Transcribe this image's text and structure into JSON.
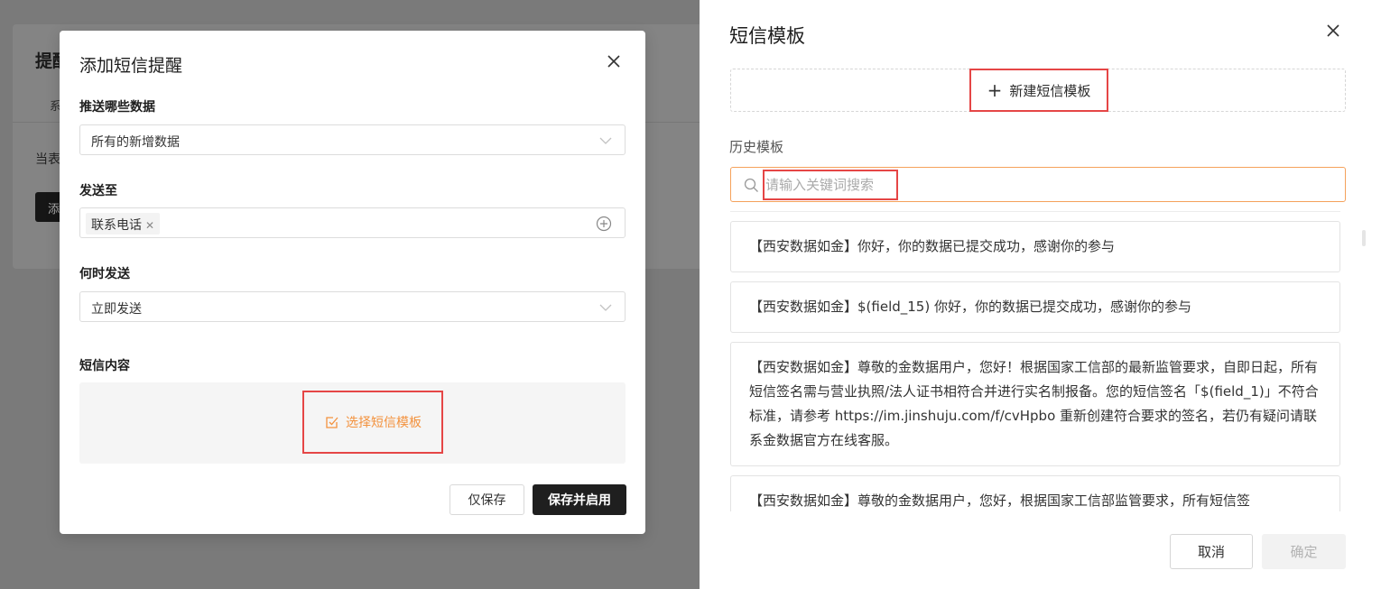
{
  "background_page": {
    "title": "提醒",
    "tab": "系",
    "text": "当表",
    "button": "添"
  },
  "modal": {
    "title": "添加短信提醒",
    "data_label": "推送哪些数据",
    "data_value": "所有的新增数据",
    "send_to_label": "发送至",
    "send_to_tag": "联系电话",
    "when_label": "何时发送",
    "when_value": "立即发送",
    "content_label": "短信内容",
    "choose_template": "选择短信模板",
    "save_only": "仅保存",
    "save_enable": "保存并启用"
  },
  "drawer": {
    "title": "短信模板",
    "new_template": "新建短信模板",
    "history_label": "历史模板",
    "search_placeholder": "请输入关键词搜索",
    "templates": [
      "【西安数据如金】你好，你的数据已提交成功，感谢你的参与",
      "【西安数据如金】$(field_15) 你好，你的数据已提交成功，感谢你的参与",
      "【西安数据如金】尊敬的金数据用户，您好！根据国家工信部的最新监管要求，自即日起，所有短信签名需与营业执照/法人证书相符合并进行实名制报备。您的短信签名「$(field_1)」不符合标准，请参考 https://im.jinshuju.com/f/cvHpbo 重新创建符合要求的签名，若仍有疑问请联系金数据官方在线客服。",
      "【西安数据如金】尊敬的金数据用户，您好，根据国家工信部监管要求，所有短信签"
    ],
    "cancel": "取消",
    "confirm": "确定"
  },
  "colors": {
    "highlight_border": "#e54646",
    "accent_orange": "#f3923e",
    "search_border": "#f5a15b",
    "primary_button": "#1f1f1f",
    "overlay": "#7a7a7a"
  }
}
